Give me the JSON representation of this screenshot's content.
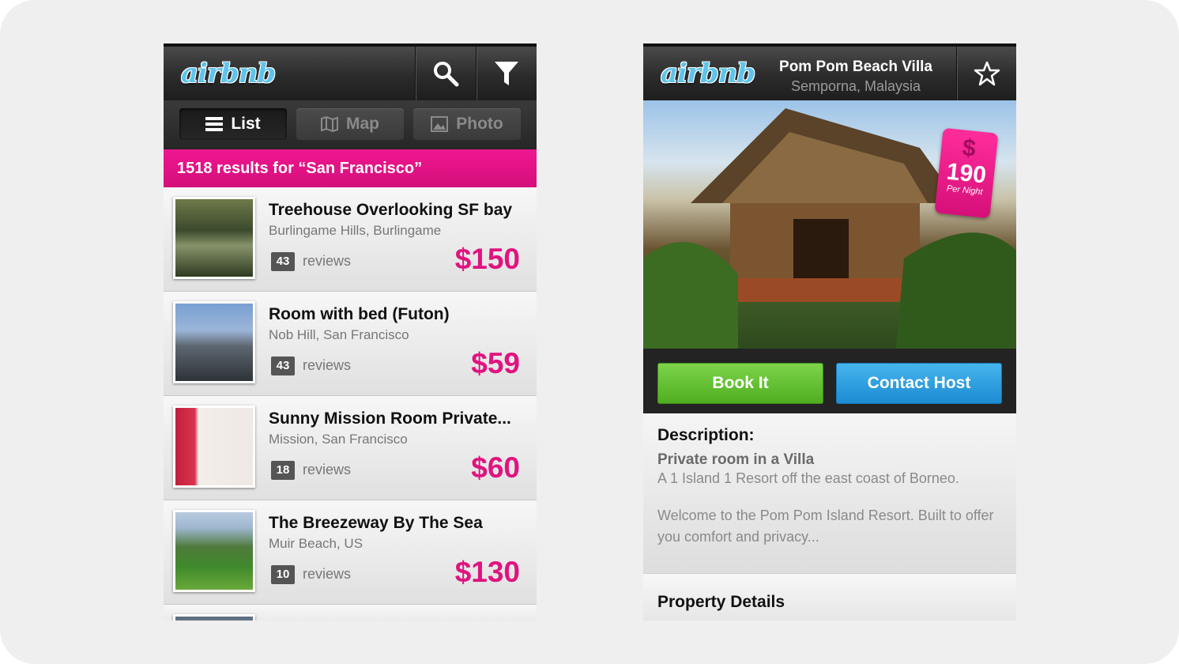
{
  "colors": {
    "brand_pink": "#e0137f",
    "book_green": "#5bbf2b",
    "contact_blue": "#2b9de0",
    "logo_blue": "#5fc3ea"
  },
  "left_screen": {
    "header": {
      "logo": "airbnb",
      "search_icon": "search-icon",
      "filter_icon": "filter-icon"
    },
    "view_tabs": [
      {
        "label": "List",
        "icon": "list-icon",
        "active": true
      },
      {
        "label": "Map",
        "icon": "map-icon",
        "active": false
      },
      {
        "label": "Photo",
        "icon": "photo-icon",
        "active": false
      }
    ],
    "results_text": "1518 results for “San Francisco”",
    "listings": [
      {
        "title": "Treehouse Overlooking SF bay",
        "location": "Burlingame Hills, Burlingame",
        "reviews_count": "43",
        "reviews_label": "reviews",
        "price": "$150"
      },
      {
        "title": "Room with bed (Futon)",
        "location": "Nob Hill, San Francisco",
        "reviews_count": "43",
        "reviews_label": "reviews",
        "price": "$59"
      },
      {
        "title": "Sunny Mission Room Private...",
        "location": "Mission, San Francisco",
        "reviews_count": "18",
        "reviews_label": "reviews",
        "price": "$60"
      },
      {
        "title": "The Breezeway By The Sea",
        "location": "Muir Beach, US",
        "reviews_count": "10",
        "reviews_label": "reviews",
        "price": "$130"
      }
    ]
  },
  "right_screen": {
    "header": {
      "logo": "airbnb",
      "name": "Pom Pom Beach Villa",
      "location": "Semporna, Malaysia",
      "favorite_icon": "star-icon"
    },
    "price_tag": {
      "currency": "$",
      "value": "190",
      "unit": "Per Night"
    },
    "actions": {
      "book": "Book It",
      "contact": "Contact Host"
    },
    "description": {
      "heading": "Description:",
      "subtitle": "Private room in a Villa",
      "line1": "A 1 Island 1 Resort off the east coast of Borneo.",
      "body": "Welcome to the Pom Pom Island Resort. Built to offer you comfort and privacy..."
    },
    "property_details": "Property Details"
  }
}
